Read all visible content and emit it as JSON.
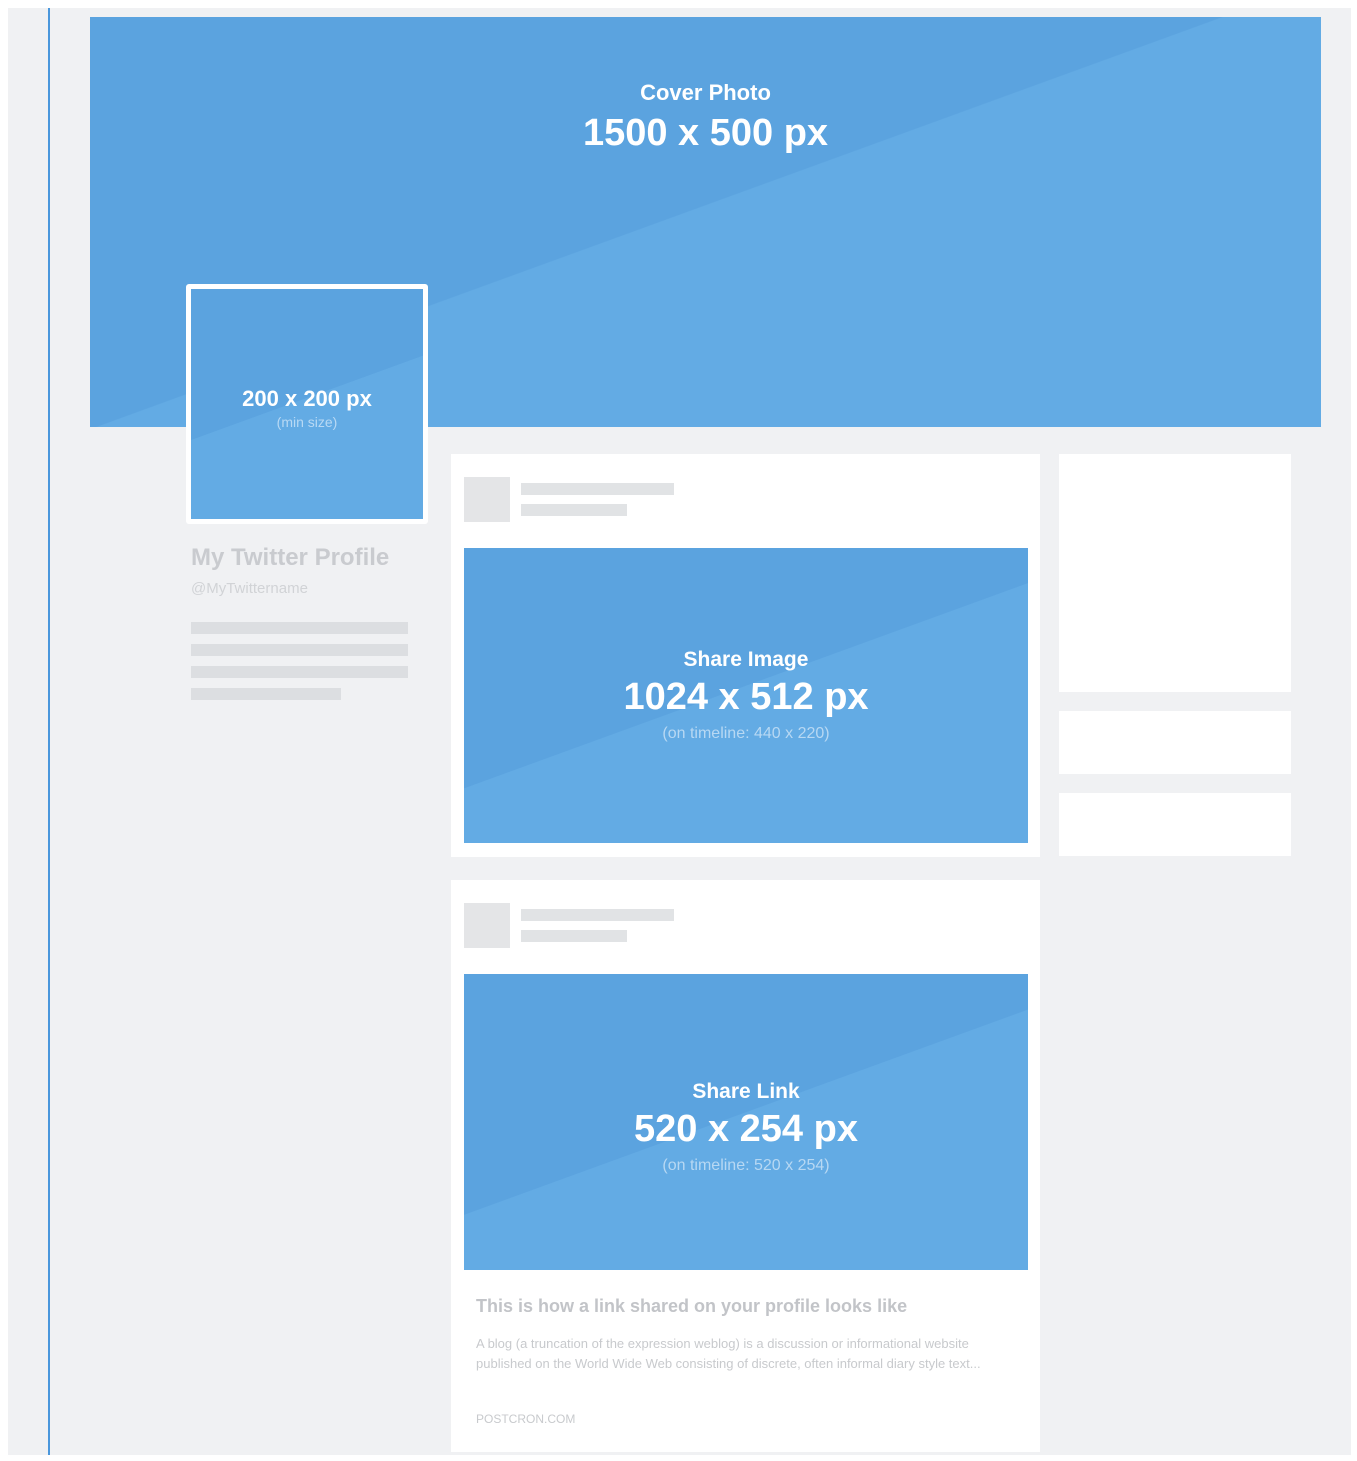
{
  "cover": {
    "label": "Cover Photo",
    "size": "1500 x 500 px"
  },
  "avatar": {
    "size": "200 x 200 px",
    "note": "(min size)"
  },
  "profile": {
    "name": "My Twitter Profile",
    "handle": "@MyTwittername"
  },
  "share_image": {
    "label": "Share Image",
    "size": "1024 x 512 px",
    "note": "(on timeline: 440 x 220)"
  },
  "share_link": {
    "label": "Share Link",
    "size": "520 x 254 px",
    "note": "(on timeline: 520 x 254)",
    "title": "This is how a link shared on your profile looks like",
    "description": "A blog (a truncation of the expression weblog) is a discussion or informational website published on the World Wide Web consisting of discrete, often informal diary style text...",
    "domain": "POSTCRON.COM"
  },
  "colors": {
    "accent_blue": "#5fa8e2",
    "background": "#f0f1f3",
    "placeholder": "#dcdee1"
  }
}
